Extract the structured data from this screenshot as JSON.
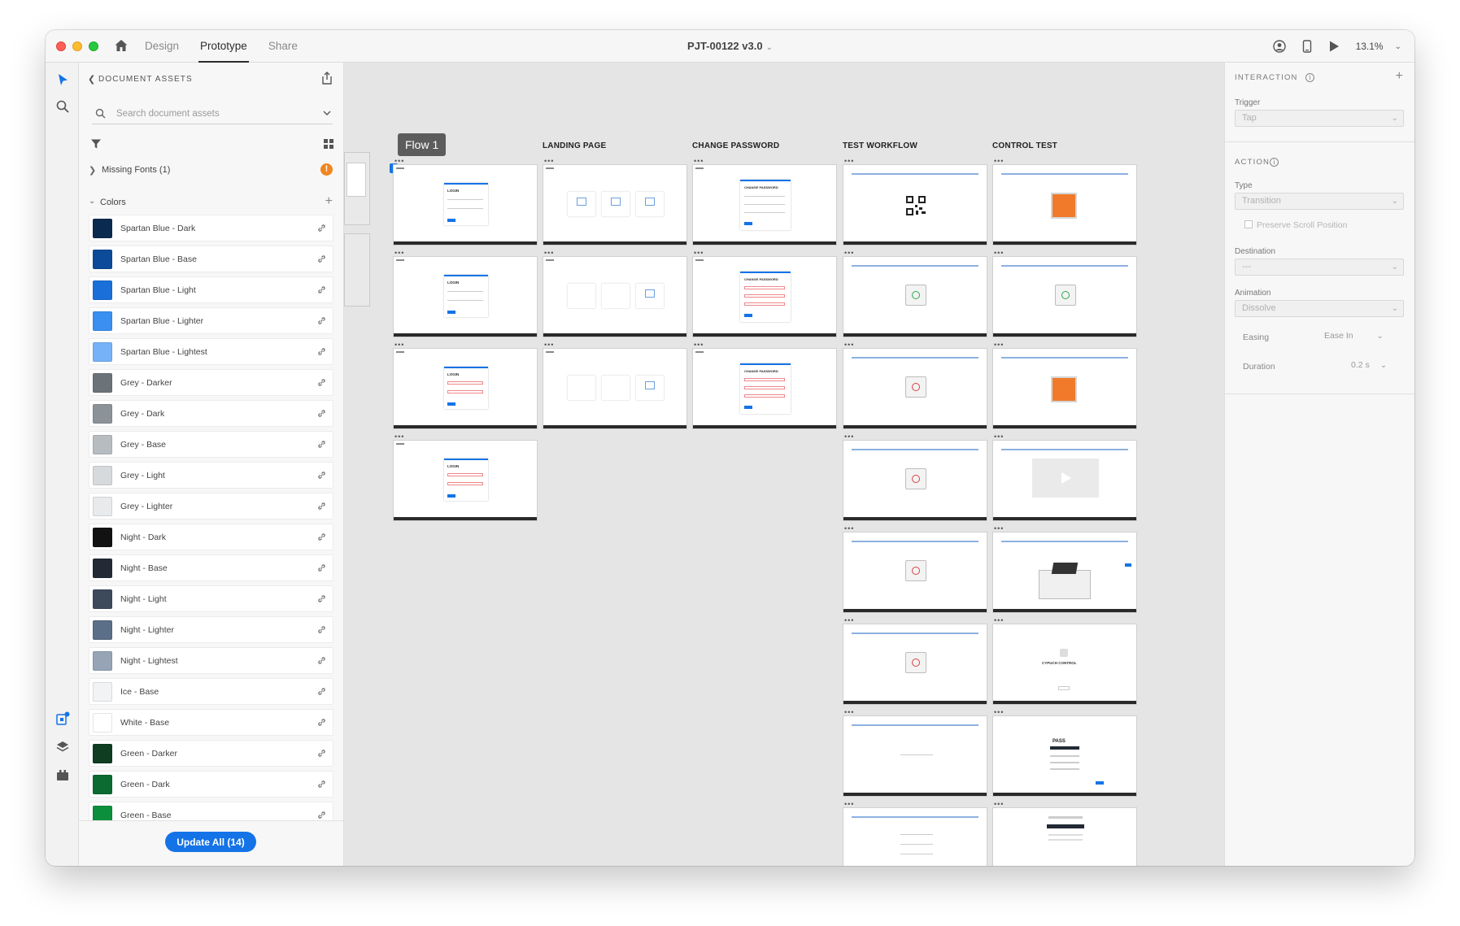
{
  "titlebar": {
    "tabs": [
      {
        "label": "Design",
        "active": false
      },
      {
        "label": "Prototype",
        "active": true
      },
      {
        "label": "Share",
        "active": false
      }
    ],
    "document_title": "PJT-00122 v3.0",
    "zoom": "13.1%"
  },
  "assets": {
    "title": "DOCUMENT ASSETS",
    "search_placeholder": "Search document assets",
    "missing_fonts_label": "Missing Fonts (1)",
    "missing_fonts_badge": "!",
    "colors_label": "Colors",
    "colors": [
      {
        "name": "Spartan Blue - Dark",
        "hex": "#0b2a4f"
      },
      {
        "name": "Spartan Blue - Base",
        "hex": "#0c4b99"
      },
      {
        "name": "Spartan Blue - Light",
        "hex": "#1a6fd8"
      },
      {
        "name": "Spartan Blue - Lighter",
        "hex": "#3a8ff0"
      },
      {
        "name": "Spartan Blue - Lightest",
        "hex": "#76b2f7"
      },
      {
        "name": "Grey - Darker",
        "hex": "#6c7378"
      },
      {
        "name": "Grey - Dark",
        "hex": "#8c9398"
      },
      {
        "name": "Grey - Base",
        "hex": "#b7bcc0"
      },
      {
        "name": "Grey - Light",
        "hex": "#d7dadc"
      },
      {
        "name": "Grey - Lighter",
        "hex": "#e8eaeb"
      },
      {
        "name": "Night - Dark",
        "hex": "#121212"
      },
      {
        "name": "Night - Base",
        "hex": "#232a36"
      },
      {
        "name": "Night - Light",
        "hex": "#3d4a5c"
      },
      {
        "name": "Night - Lighter",
        "hex": "#5c6f88"
      },
      {
        "name": "Night - Lightest",
        "hex": "#96a4b6"
      },
      {
        "name": "Ice - Base",
        "hex": "#f1f3f5"
      },
      {
        "name": "White - Base",
        "hex": "#ffffff"
      },
      {
        "name": "Green - Darker",
        "hex": "#0f3d21"
      },
      {
        "name": "Green - Dark",
        "hex": "#0b6b30"
      },
      {
        "name": "Green - Base",
        "hex": "#0c8f3d"
      }
    ],
    "update_button": "Update All (14)"
  },
  "canvas": {
    "flow_label": "Flow 1",
    "columns": [
      "LANDING PAGE",
      "CHANGE PASSWORD",
      "TEST WORKFLOW",
      "CONTROL TEST"
    ],
    "login_label": "LOGIN",
    "change_password_label": "CHANGE PASSWORD",
    "pass_label": "PASS",
    "control_label": "CYPUCH CONTROL"
  },
  "inspector": {
    "interaction_title": "INTERACTION",
    "trigger_label": "Trigger",
    "trigger_value": "Tap",
    "action_title": "ACTION",
    "type_label": "Type",
    "type_value": "Transition",
    "preserve_scroll": "Preserve Scroll Position",
    "destination_label": "Destination",
    "destination_value": "---",
    "animation_label": "Animation",
    "animation_value": "Dissolve",
    "easing_label": "Easing",
    "easing_value": "Ease In",
    "duration_label": "Duration",
    "duration_value": "0.2 s"
  },
  "colors": {
    "accent": "#1473e6",
    "warning": "#f0861f",
    "canvas_bg": "#e5e5e5"
  }
}
